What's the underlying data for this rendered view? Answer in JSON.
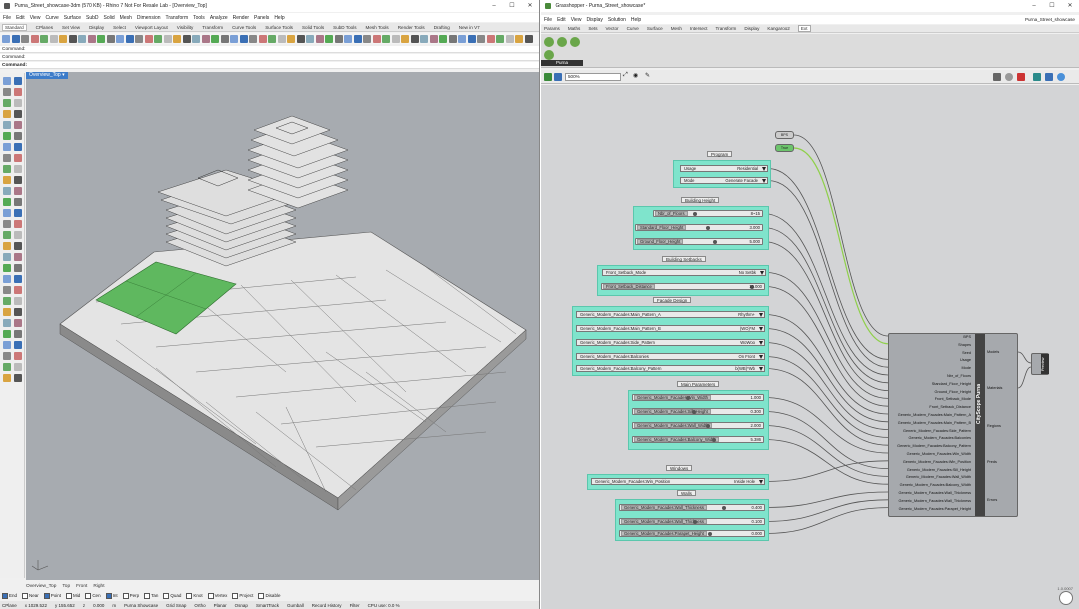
{
  "rhino": {
    "title": "Purna_Street_showcase-3dm (570 KB) - Rhino 7 Not For Resale Lab - [Overview_Top]",
    "menu": [
      "File",
      "Edit",
      "View",
      "Curve",
      "Surface",
      "SubD",
      "Solid",
      "Mesh",
      "Dimension",
      "Transform",
      "Tools",
      "Analyze",
      "Render",
      "Panels",
      "Help"
    ],
    "tabs": [
      "Standard",
      "CPlanes",
      "Set View",
      "Display",
      "Select",
      "Viewport Layout",
      "Visibility",
      "Transform",
      "Curve Tools",
      "Surface Tools",
      "Solid Tools",
      "SubD Tools",
      "Mesh Tools",
      "Render Tools",
      "Drafting",
      "New in V7"
    ],
    "command_history": [
      "Command:",
      "Command:"
    ],
    "command_prompt": "Command:",
    "viewport_label": "Overview_Top",
    "viewport_tabs": [
      "Overview_Top",
      "Top",
      "Front",
      "Right"
    ],
    "osnaps": [
      {
        "label": "End",
        "on": true
      },
      {
        "label": "Near",
        "on": false
      },
      {
        "label": "Point",
        "on": true
      },
      {
        "label": "Mid",
        "on": false
      },
      {
        "label": "Cen",
        "on": false
      },
      {
        "label": "Int",
        "on": true
      },
      {
        "label": "Perp",
        "on": false
      },
      {
        "label": "Tan",
        "on": false
      },
      {
        "label": "Quad",
        "on": false
      },
      {
        "label": "Knot",
        "on": false
      },
      {
        "label": "Vertex",
        "on": false
      },
      {
        "label": "Project",
        "on": false
      },
      {
        "label": "Disable",
        "on": false
      }
    ],
    "status": [
      "CPlane",
      "x 1029.522",
      "y 155.652",
      "z",
      "0.000",
      "m",
      "Purna Showcase",
      "Grid Snap",
      "Ortho",
      "Planar",
      "Osnap",
      "SmartTrack",
      "Gumball",
      "Record History",
      "Filter",
      "CPU use: 0.0 %"
    ]
  },
  "gh": {
    "title": "Grasshopper - Purna_Street_showcase*",
    "doc_name": "Purna_Street_showcase",
    "menu": [
      "File",
      "Edit",
      "View",
      "Display",
      "Solution",
      "Help"
    ],
    "tabs": [
      "Params",
      "Maths",
      "Sets",
      "Vector",
      "Curve",
      "Surface",
      "Mesh",
      "Intersect",
      "Transform",
      "Display",
      "Kangaroo2",
      "Ext"
    ],
    "active_tab": "Ext",
    "panel_label": "Purna",
    "zoom": "500%",
    "toggles": [
      {
        "label": "BPS"
      },
      {
        "label": "True"
      }
    ],
    "groups": {
      "program": "Program",
      "height": "Building Height",
      "setbacks": "Building Setbacks",
      "facade": "Facade Design",
      "params": "Main Parameters",
      "windows": "Windows",
      "walls": "Walls"
    },
    "dropdowns": [
      {
        "name": "Usage",
        "value": "Residential"
      },
      {
        "name": "Mode",
        "value": "Generate Facade"
      },
      {
        "name": "Front_Setback_Mode",
        "value": "No Setbk"
      },
      {
        "name": "Generic_Modern_Facades:Main_Pattern_A",
        "value": "Rhythm+"
      },
      {
        "name": "Generic_Modern_Facades:Main_Pattern_B",
        "value": "(WO)*M"
      },
      {
        "name": "Generic_Modern_Facades:Side_Pattern",
        "value": "WoWoo"
      },
      {
        "name": "Generic_Modern_Facades:Balconies",
        "value": "On Front"
      },
      {
        "name": "Generic_Modern_Facades:Balcony_Pattern",
        "value": "b(WB)*Wb"
      },
      {
        "name": "Generic_Modern_Facades:Win_Position",
        "value": "Inside Hole"
      }
    ],
    "sliders": [
      {
        "name": "Nbr_of_Floors",
        "value": "8~15"
      },
      {
        "name": "Standard_Floor_Height",
        "value": "3.000"
      },
      {
        "name": "Ground_Floor_Height",
        "value": "5.000"
      },
      {
        "name": "Front_Setback_Distance",
        "value": "10.000"
      },
      {
        "name": "Generic_Modern_Facades:Win_Width",
        "value": "1.000"
      },
      {
        "name": "Generic_Modern_Facades:Sill_Height",
        "value": "0.300"
      },
      {
        "name": "Generic_Modern_Facades:Wall_Width",
        "value": "2.000"
      },
      {
        "name": "Generic_Modern_Facades:Balcony_Width",
        "value": "5.386"
      },
      {
        "name": "Generic_Modern_Facades:Wall_Thickness",
        "value": "0.400"
      },
      {
        "name": "Generic_Modern_Facades:Wall_Thickness",
        "value": "0.100"
      },
      {
        "name": "Generic_Modern_Facades:Parapet_Height",
        "value": "0.000"
      }
    ],
    "component": {
      "name": "CityScope Purna",
      "inputs": [
        "BPS",
        "Shapes",
        "Seed",
        "Usage",
        "Mode",
        "Nbr_of_Floors",
        "Standard_Floor_Height",
        "Ground_Floor_Height",
        "Front_Setback_Mode",
        "Front_Setback_Distance",
        "Generic_Modern_Facades:Main_Pattern_A",
        "Generic_Modern_Facades:Main_Pattern_B",
        "Generic_Modern_Facades:Side_Pattern",
        "Generic_Modern_Facades:Balconies",
        "Generic_Modern_Facades:Balcony_Pattern",
        "Generic_Modern_Facades:Win_Width",
        "Generic_Modern_Facades:Win_Position",
        "Generic_Modern_Facades:Sill_Height",
        "Generic_Modern_Facades:Wall_Width",
        "Generic_Modern_Facades:Balcony_Width",
        "Generic_Modern_Facades:Wall_Thickness",
        "Generic_Modern_Facades:Wall_Thickness",
        "Generic_Modern_Facades:Parapet_Height"
      ],
      "outputs": [
        "Models",
        "Materials",
        "Regions",
        "Preds",
        "Errors"
      ]
    },
    "preview_label": "Preview",
    "version": "1.0.0007"
  }
}
